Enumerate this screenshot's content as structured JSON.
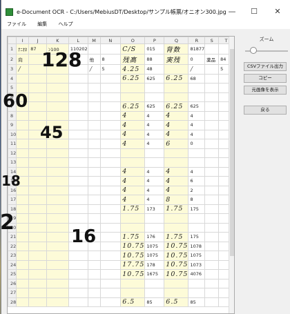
{
  "window": {
    "title": "e-Document OCR - C:/Users/MebiusDT/Desktop/サンプル帳票/オニオン300.jpg",
    "minimize": "—",
    "maximize": "☐",
    "close": "✕"
  },
  "menu": [
    "ファイル",
    "編集",
    "ヘルプ"
  ],
  "sheet": {
    "columns": [
      "",
      "I",
      "J",
      "K",
      "L",
      "M",
      "N",
      "O",
      "P",
      "Q",
      "R",
      "S",
      "T"
    ],
    "rows": [
      {
        "n": "1",
        "c": [
          "ﾅﾆｵﾈ",
          "87",
          "ﾝ100",
          "110202",
          "",
          "",
          "C/S",
          "015",
          "背数",
          "81877",
          "",
          ""
        ]
      },
      {
        "n": "2",
        "c": [
          "向",
          "",
          "",
          "15",
          "他",
          "8",
          "残高",
          "88",
          "実残",
          "0",
          "薬品",
          "84"
        ]
      },
      {
        "n": "3",
        "c": [
          "╱",
          "",
          "",
          "",
          "╱",
          "5",
          "4.25",
          "48",
          "",
          "╱",
          "",
          "5"
        ]
      },
      {
        "n": "4",
        "c": [
          "",
          "",
          "",
          "",
          "",
          "",
          "6.25",
          "625",
          "6.25",
          "68",
          "",
          ""
        ]
      },
      {
        "n": "5",
        "c": [
          "",
          "",
          "",
          "",
          "",
          "",
          "",
          "",
          "",
          "",
          "",
          ""
        ]
      },
      {
        "n": "6",
        "c": [
          "",
          "",
          "",
          "",
          "",
          "",
          "",
          "",
          "",
          "",
          "",
          ""
        ]
      },
      {
        "n": "7",
        "c": [
          "",
          "",
          "",
          "",
          "",
          "",
          "6.25",
          "625",
          "6.25",
          "625",
          "",
          ""
        ]
      },
      {
        "n": "8",
        "c": [
          "",
          "",
          "",
          "",
          "",
          "",
          "4",
          "4",
          "4",
          "4",
          "",
          ""
        ]
      },
      {
        "n": "9",
        "c": [
          "",
          "",
          "",
          "",
          "",
          "",
          "4",
          "4",
          "4",
          "4",
          "",
          ""
        ]
      },
      {
        "n": "10",
        "c": [
          "",
          "",
          "",
          "",
          "",
          "",
          "4",
          "4",
          "4",
          "4",
          "",
          ""
        ]
      },
      {
        "n": "11",
        "c": [
          "",
          "",
          "",
          "",
          "",
          "",
          "4",
          "4",
          "6",
          "0",
          "",
          ""
        ]
      },
      {
        "n": "12",
        "c": [
          "",
          "",
          "",
          "",
          "",
          "",
          "",
          "",
          "",
          "",
          "",
          ""
        ]
      },
      {
        "n": "13",
        "c": [
          "",
          "",
          "",
          "",
          "",
          "",
          "",
          "",
          "",
          "",
          "",
          ""
        ]
      },
      {
        "n": "14",
        "c": [
          "",
          "",
          "",
          "",
          "",
          "",
          "4",
          "4",
          "4",
          "4",
          "",
          ""
        ]
      },
      {
        "n": "15",
        "c": [
          "",
          "",
          "",
          "",
          "",
          "",
          "4",
          "4",
          "4",
          "6",
          "",
          ""
        ]
      },
      {
        "n": "16",
        "c": [
          "",
          "",
          "",
          "",
          "",
          "",
          "4",
          "4",
          "4",
          "2",
          "",
          ""
        ]
      },
      {
        "n": "17",
        "c": [
          "",
          "",
          "",
          "",
          "",
          "",
          "4",
          "4",
          "8",
          "8",
          "",
          ""
        ]
      },
      {
        "n": "18",
        "c": [
          "",
          "",
          "",
          "",
          "",
          "",
          "1.75",
          "173",
          "1.75",
          "175",
          "",
          ""
        ]
      },
      {
        "n": "19",
        "c": [
          "",
          "",
          "",
          "",
          "",
          "",
          "",
          "",
          "",
          "",
          "",
          ""
        ]
      },
      {
        "n": "20",
        "c": [
          "",
          "",
          "",
          "",
          "",
          "",
          "",
          "",
          "",
          "",
          "",
          ""
        ]
      },
      {
        "n": "21",
        "c": [
          "",
          "",
          "",
          "",
          "",
          "",
          "1.75",
          "176",
          "1.75",
          "175",
          "",
          ""
        ]
      },
      {
        "n": "22",
        "c": [
          "",
          "",
          "",
          "",
          "",
          "",
          "10.75",
          "1075",
          "10.75",
          "1078",
          "",
          ""
        ]
      },
      {
        "n": "23",
        "c": [
          "",
          "",
          "",
          "",
          "",
          "",
          "10.75",
          "1075",
          "10.75",
          "1075",
          "",
          ""
        ]
      },
      {
        "n": "24",
        "c": [
          "",
          "",
          "",
          "",
          "",
          "",
          "17.75",
          "178",
          "10.75",
          "1073",
          "",
          ""
        ]
      },
      {
        "n": "25",
        "c": [
          "",
          "",
          "",
          "",
          "",
          "",
          "10.75",
          "1675",
          "10.75",
          "4076",
          "",
          ""
        ]
      },
      {
        "n": "26",
        "c": [
          "",
          "",
          "",
          "",
          "",
          "",
          "",
          "",
          "",
          "",
          "",
          ""
        ]
      },
      {
        "n": "27",
        "c": [
          "",
          "",
          "",
          "",
          "",
          "",
          "",
          "",
          "",
          "",
          "",
          ""
        ]
      },
      {
        "n": "28",
        "c": [
          "",
          "",
          "",
          "",
          "",
          "",
          "6.5",
          "85",
          "6.5",
          "85",
          "",
          ""
        ]
      }
    ],
    "row2_overflow": "(異"
  },
  "panel": {
    "zoom_label": "ズーム",
    "zoom_level": 0.2,
    "csv_button": "CSVファイル出力",
    "copy_button": "コピー",
    "show_original_button": "元画像を表示",
    "back_button": "戻る"
  },
  "overlay": {
    "n128": "128",
    "n60": "60",
    "n45": "45",
    "n18": "18",
    "n16": "16",
    "n2": "2"
  }
}
